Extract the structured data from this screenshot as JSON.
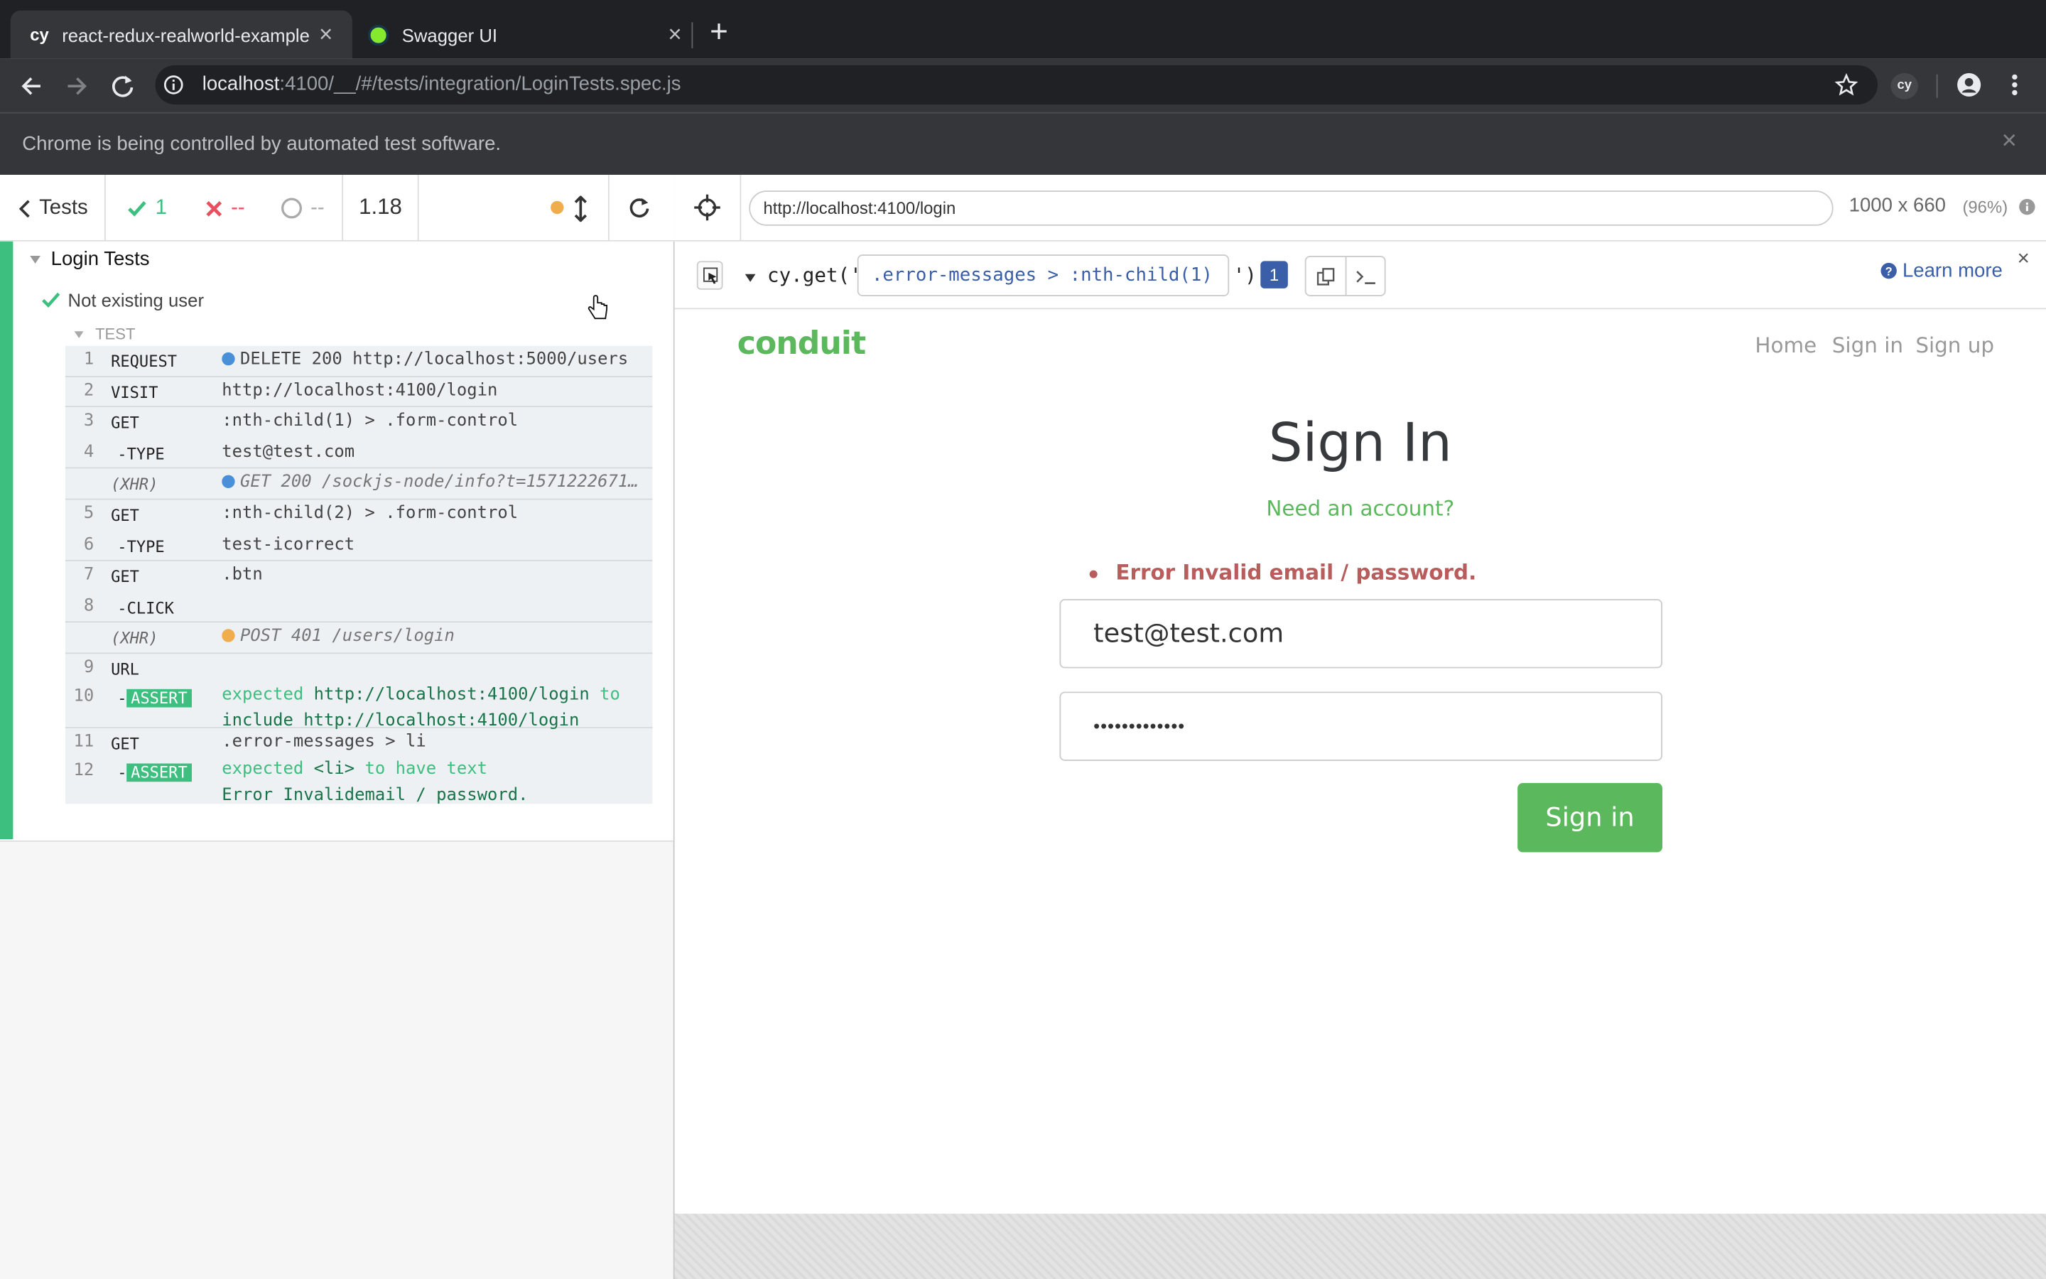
{
  "browser": {
    "tabs": [
      {
        "icon": "cy",
        "title": "react-redux-realworld-example",
        "close": "×"
      },
      {
        "title": "Swagger UI",
        "close": "×"
      }
    ],
    "new_tab": "+",
    "address_host": "localhost",
    "address_rest": ":4100/__/#/tests/integration/LoginTests.spec.js",
    "extension_label": "cy",
    "infobar_text": "Chrome is being controlled by automated test software.",
    "infobar_close": "×"
  },
  "reporter": {
    "back_label": "Tests",
    "passed": "1",
    "failed": "--",
    "pending": "--",
    "duration": "1.18",
    "suite_title": "Login Tests",
    "test_title": "Not existing user",
    "section_label": "TEST",
    "commands": [
      {
        "num": "1",
        "name": "REQUEST",
        "msg": "DELETE 200 http://localhost:5000/users",
        "dot": "#4a90d9",
        "sep": true
      },
      {
        "num": "2",
        "name": "VISIT",
        "msg": "http://localhost:4100/login",
        "sep": true
      },
      {
        "num": "3",
        "name": "GET",
        "msg": ":nth-child(1) > .form-control"
      },
      {
        "num": "4",
        "name": "-TYPE",
        "msg": "test@test.com",
        "sep": true
      },
      {
        "num": "",
        "name": "(XHR)",
        "msg": "GET 200 /sockjs-node/info?t=1571222671…",
        "dot": "#4a90d9",
        "italic": true,
        "sep": true
      },
      {
        "num": "5",
        "name": "GET",
        "msg": ":nth-child(2) > .form-control"
      },
      {
        "num": "6",
        "name": "-TYPE",
        "msg": "test-icorrect",
        "sep": true
      },
      {
        "num": "7",
        "name": "GET",
        "msg": ".btn"
      },
      {
        "num": "8",
        "name": "-CLICK",
        "msg": "",
        "sep": true
      },
      {
        "num": "",
        "name": "(XHR)",
        "msg": "POST 401 /users/login",
        "dot": "#f0ad4e",
        "italic": true,
        "sep": true
      },
      {
        "num": "9",
        "name": "URL",
        "msg": ""
      },
      {
        "num": "10",
        "name": "-ASSERT",
        "assert": true,
        "msg_parts": [
          "expected ",
          "http://localhost:4100/login",
          " to",
          "include ",
          "http://localhost:4100/login"
        ],
        "sep": true
      },
      {
        "num": "11",
        "name": "GET",
        "msg": ".error-messages > li"
      },
      {
        "num": "12",
        "name": "-ASSERT",
        "assert": true,
        "msg_parts": [
          "expected ",
          "<li>",
          " to have text ",
          "Error Invalid",
          "email / password."
        ]
      }
    ]
  },
  "aut": {
    "url": "http://localhost:4100/login",
    "viewport": "1000 x 660",
    "scale": "(96%)",
    "selector_prefix": "cy.get('",
    "selector_value": ".error-messages > :nth-child(1)",
    "selector_suffix": "')",
    "match_count": "1",
    "learn_more": "Learn more",
    "close": "×"
  },
  "app": {
    "brand": "conduit",
    "nav": [
      "Home",
      "Sign in",
      "Sign up"
    ],
    "heading": "Sign In",
    "need_account": "Need an account?",
    "error": "Error Invalid email / password.",
    "email_value": "test@test.com",
    "password_dots": "•••••••••••••",
    "submit_label": "Sign in",
    "brand_color": "#5cb85c",
    "error_color": "#b85c5c"
  }
}
